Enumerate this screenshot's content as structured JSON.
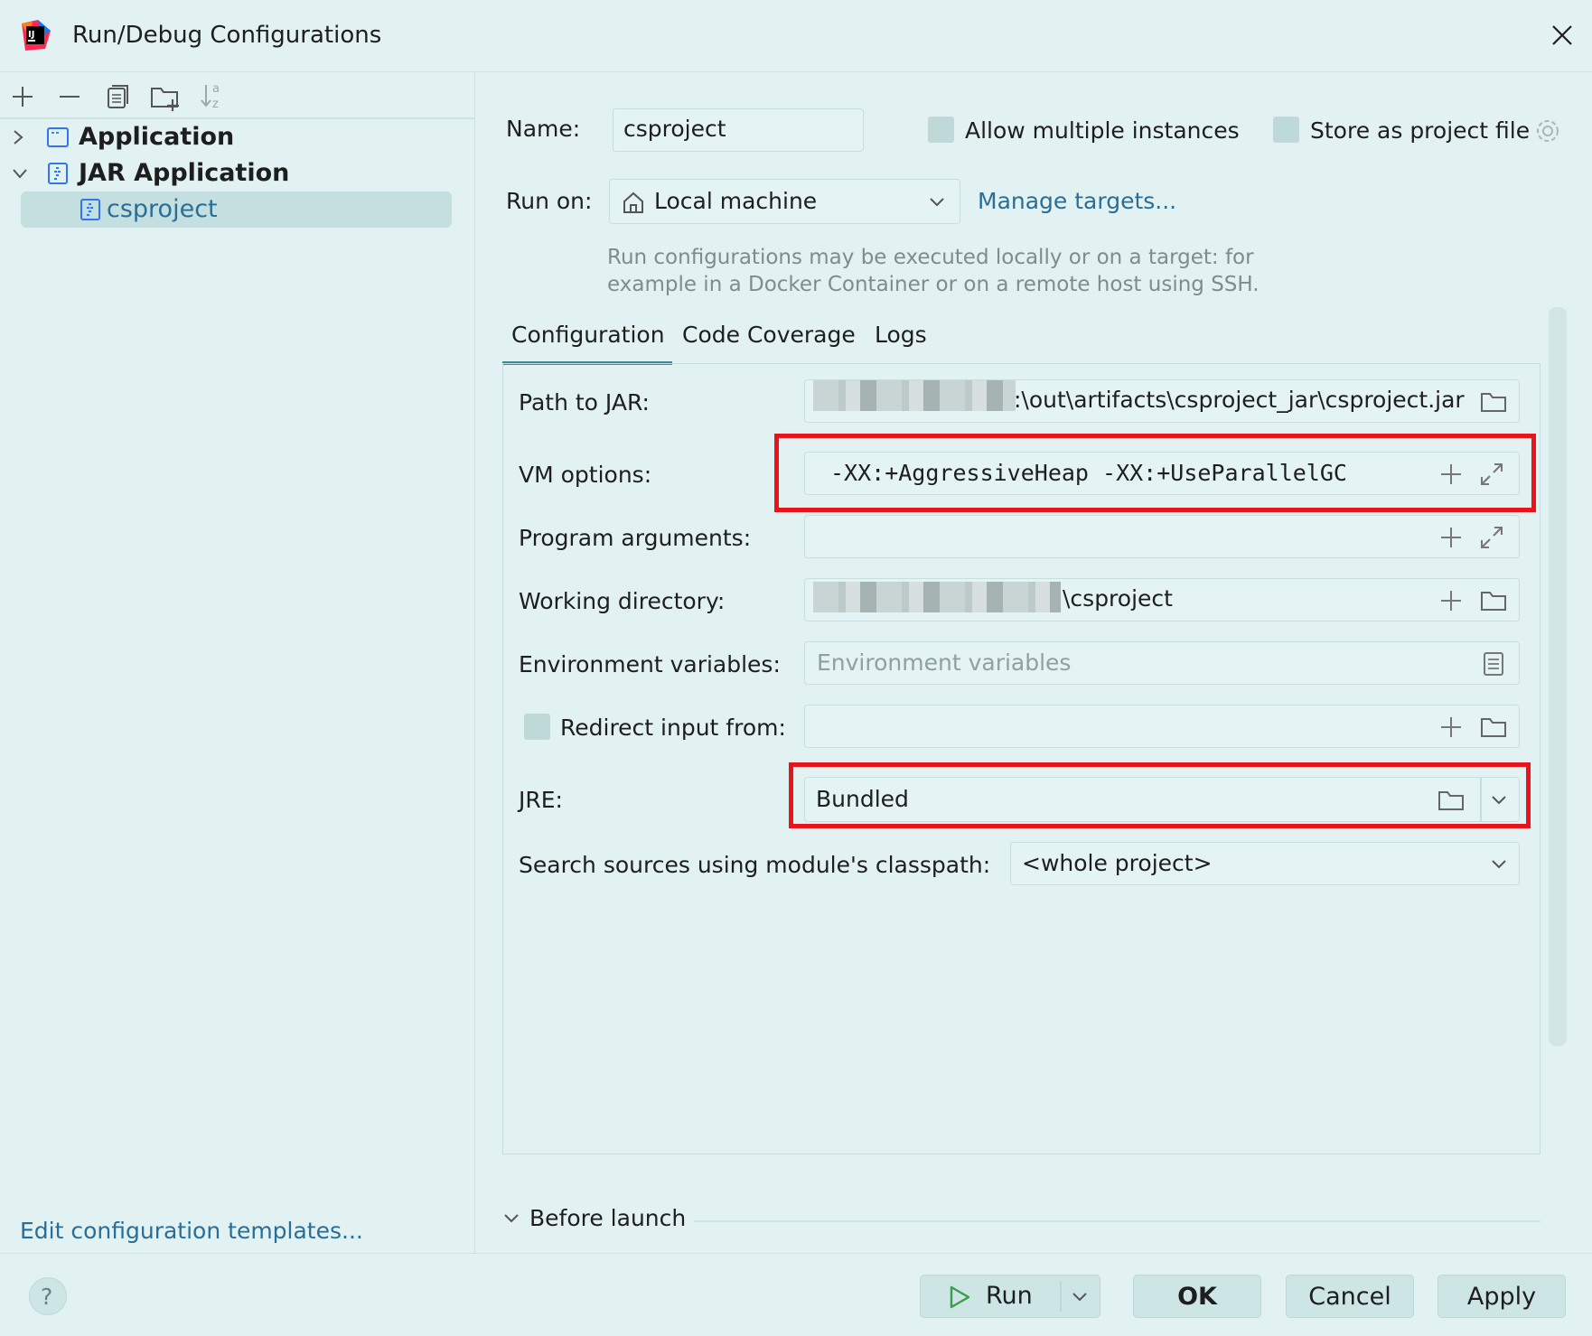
{
  "window": {
    "title": "Run/Debug Configurations"
  },
  "toolbar": {
    "icons": [
      "add-icon",
      "remove-icon",
      "copy-icon",
      "new-folder-icon",
      "sort-icon"
    ]
  },
  "tree": {
    "items": [
      {
        "label": "Application",
        "expanded": false
      },
      {
        "label": "JAR Application",
        "expanded": true
      },
      {
        "label": "csproject",
        "selected": true
      }
    ]
  },
  "sidebar": {
    "edit_templates_link": "Edit configuration templates..."
  },
  "form": {
    "name_label": "Name:",
    "name_value": "csproject",
    "allow_multiple_label": "Allow multiple instances",
    "store_project_label": "Store as project file",
    "run_on_label": "Run on:",
    "run_on_value": "Local machine",
    "manage_targets_link": "Manage targets...",
    "hint_line1": "Run configurations may be executed locally or on a target: for",
    "hint_line2": "example in a Docker Container or on a remote host using SSH."
  },
  "tabs": [
    {
      "label": "Configuration",
      "active": true
    },
    {
      "label": "Code Coverage",
      "active": false
    },
    {
      "label": "Logs",
      "active": false
    }
  ],
  "config": {
    "path_to_jar_label": "Path to JAR:",
    "path_to_jar_value": ":\\out\\artifacts\\csproject_jar\\csproject.jar",
    "vm_options_label": "VM options:",
    "vm_options_value": "-XX:+AggressiveHeap -XX:+UseParallelGC",
    "program_args_label": "Program arguments:",
    "working_dir_label": "Working directory:",
    "working_dir_value": "\\csproject",
    "env_vars_label": "Environment variables:",
    "env_vars_placeholder": "Environment variables",
    "redirect_label": "Redirect input from:",
    "jre_label": "JRE:",
    "jre_value": "Bundled",
    "search_sources_label": "Search sources using module's classpath:",
    "search_sources_value": "<whole project>"
  },
  "before_launch": {
    "label": "Before launch"
  },
  "footer": {
    "help_label": "?",
    "run_label": "Run",
    "ok_label": "OK",
    "cancel_label": "Cancel",
    "apply_label": "Apply"
  },
  "colors": {
    "background": "#e2f2f2",
    "selected": "#c4dfdf",
    "link": "#2a6e98",
    "highlight": "#e8141c",
    "run_icon": "#3a9e4a"
  }
}
